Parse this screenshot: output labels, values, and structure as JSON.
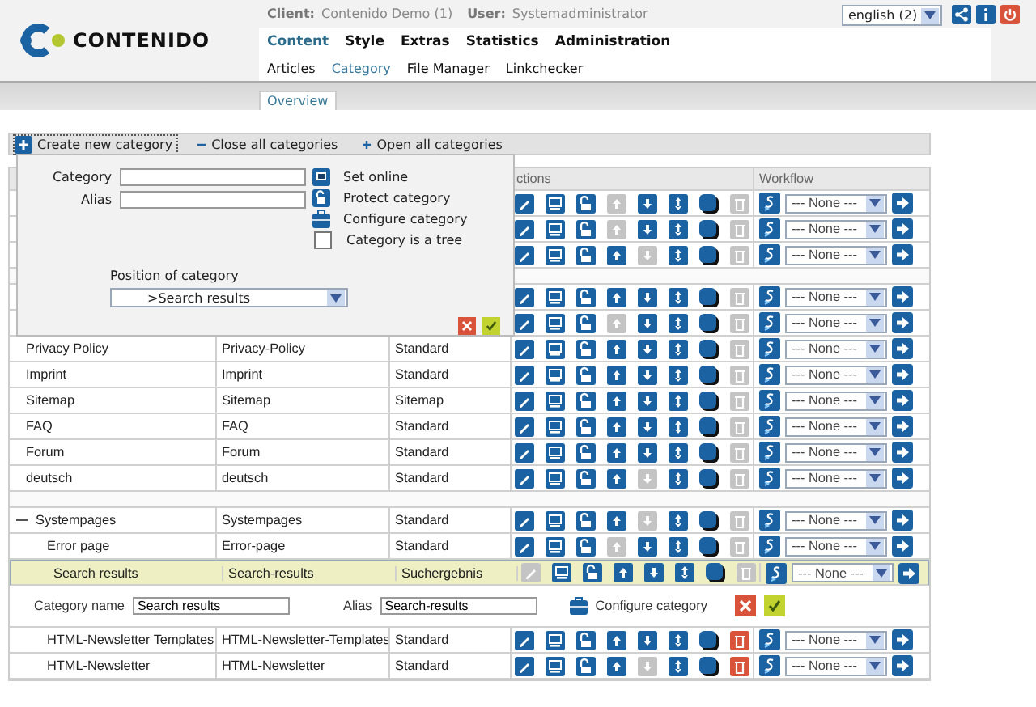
{
  "header": {
    "logo": "CONTENIDO",
    "client_label": "Client:",
    "client": "Contenido Demo (1)",
    "user_label": "User:",
    "user": "Systemadministrator",
    "language": "english (2)"
  },
  "main_menu": [
    {
      "label": "Content",
      "selected": true
    },
    {
      "label": "Style",
      "selected": false
    },
    {
      "label": "Extras",
      "selected": false
    },
    {
      "label": "Statistics",
      "selected": false
    },
    {
      "label": "Administration",
      "selected": false
    }
  ],
  "sub_menu": [
    {
      "label": "Articles",
      "selected": false
    },
    {
      "label": "Category",
      "selected": true
    },
    {
      "label": "File Manager",
      "selected": false
    },
    {
      "label": "Linkchecker",
      "selected": false
    }
  ],
  "tabs": [
    {
      "label": "Overview",
      "selected": true
    }
  ],
  "toolbar": [
    {
      "kind": "create",
      "label": "Create new category",
      "focused": true
    },
    {
      "kind": "close",
      "label": "Close all categories",
      "focused": false
    },
    {
      "kind": "open",
      "label": "Open all categories",
      "focused": false
    }
  ],
  "new_category_form": {
    "category_label": "Category",
    "alias_label": "Alias",
    "options": [
      {
        "kind": "online",
        "label": "Set online"
      },
      {
        "kind": "protect",
        "label": "Protect category"
      },
      {
        "kind": "configure",
        "label": "Configure category"
      },
      {
        "kind": "checkbox",
        "label": "Category is a tree",
        "checked": false
      }
    ],
    "position_label": "Position of category",
    "position": ">Search results"
  },
  "table": {
    "columns": [
      "ctions",
      "Workflow"
    ],
    "rows": [
      {
        "kind": "category",
        "selected": false,
        "actions_enabled": [
          true,
          true,
          true,
          false,
          true,
          true,
          true,
          false
        ],
        "workflow": "--- None ---"
      },
      {
        "kind": "category",
        "selected": false,
        "actions_enabled": [
          true,
          true,
          true,
          false,
          true,
          true,
          true,
          false
        ],
        "workflow": "--- None ---"
      },
      {
        "kind": "category",
        "selected": false,
        "actions_enabled": [
          true,
          true,
          true,
          true,
          false,
          true,
          true,
          false
        ],
        "workflow": "--- None ---"
      },
      {
        "kind": "spacer"
      },
      {
        "kind": "category",
        "selected": false,
        "actions_enabled": [
          true,
          true,
          true,
          true,
          true,
          true,
          true,
          false
        ],
        "workflow": "--- None ---"
      },
      {
        "kind": "category",
        "selected": false,
        "actions_enabled": [
          true,
          true,
          true,
          false,
          true,
          true,
          true,
          false
        ],
        "workflow": "--- None ---"
      },
      {
        "kind": "category",
        "name": "Privacy Policy",
        "alias": "Privacy-Policy",
        "template": "Standard",
        "selected": false,
        "actions_enabled": [
          true,
          true,
          true,
          true,
          true,
          true,
          true,
          false
        ],
        "workflow": "--- None ---"
      },
      {
        "kind": "category",
        "name": "Imprint",
        "alias": "Imprint",
        "template": "Standard",
        "selected": false,
        "actions_enabled": [
          true,
          true,
          true,
          true,
          true,
          true,
          true,
          false
        ],
        "workflow": "--- None ---"
      },
      {
        "kind": "category",
        "name": "Sitemap",
        "alias": "Sitemap",
        "template": "Sitemap",
        "selected": false,
        "actions_enabled": [
          true,
          true,
          true,
          true,
          true,
          true,
          true,
          false
        ],
        "workflow": "--- None ---"
      },
      {
        "kind": "category",
        "name": "FAQ",
        "alias": "FAQ",
        "template": "Standard",
        "selected": false,
        "actions_enabled": [
          true,
          true,
          true,
          true,
          true,
          true,
          true,
          false
        ],
        "workflow": "--- None ---"
      },
      {
        "kind": "category",
        "name": "Forum",
        "alias": "Forum",
        "template": "Standard",
        "selected": false,
        "actions_enabled": [
          true,
          true,
          true,
          true,
          true,
          true,
          true,
          false
        ],
        "workflow": "--- None ---"
      },
      {
        "kind": "category",
        "name": "deutsch",
        "alias": "deutsch",
        "template": "Standard",
        "selected": false,
        "actions_enabled": [
          true,
          true,
          true,
          true,
          false,
          true,
          true,
          false
        ],
        "workflow": "--- None ---"
      },
      {
        "kind": "spacer"
      },
      {
        "kind": "category",
        "name": "Systempages",
        "alias": "Systempages",
        "template": "Standard",
        "selected": false,
        "expanded": true,
        "actions_enabled": [
          true,
          true,
          true,
          true,
          false,
          true,
          true,
          false
        ],
        "workflow": "--- None ---",
        "children": [
          {
            "kind": "category",
            "name": "Error page",
            "alias": "Error-page",
            "template": "Standard",
            "selected": false,
            "actions_enabled": [
              true,
              true,
              true,
              false,
              true,
              true,
              true,
              false
            ],
            "workflow": "--- None ---"
          },
          {
            "kind": "category",
            "name": "Search results",
            "alias": "Search-results",
            "template": "Suchergebnis",
            "selected": true,
            "actions_enabled": [
              false,
              true,
              true,
              true,
              true,
              true,
              true,
              false
            ],
            "workflow": "--- None ---",
            "editor": {
              "name_label": "Category name",
              "name": "Search results",
              "alias_label": "Alias",
              "alias": "Search-results",
              "configure_label": "Configure category"
            }
          },
          {
            "kind": "category",
            "name": "HTML-Newsletter Templates",
            "alias": "HTML-Newsletter-Templates",
            "template": "Standard",
            "selected": false,
            "actions_enabled": [
              true,
              true,
              true,
              true,
              true,
              true,
              true,
              true
            ],
            "workflow": "--- None ---"
          },
          {
            "kind": "category",
            "name": "HTML-Newsletter",
            "alias": "HTML-Newsletter",
            "template": "Standard",
            "selected": false,
            "actions_enabled": [
              true,
              true,
              true,
              true,
              false,
              true,
              true,
              true
            ],
            "workflow": "--- None ---"
          }
        ]
      }
    ]
  }
}
